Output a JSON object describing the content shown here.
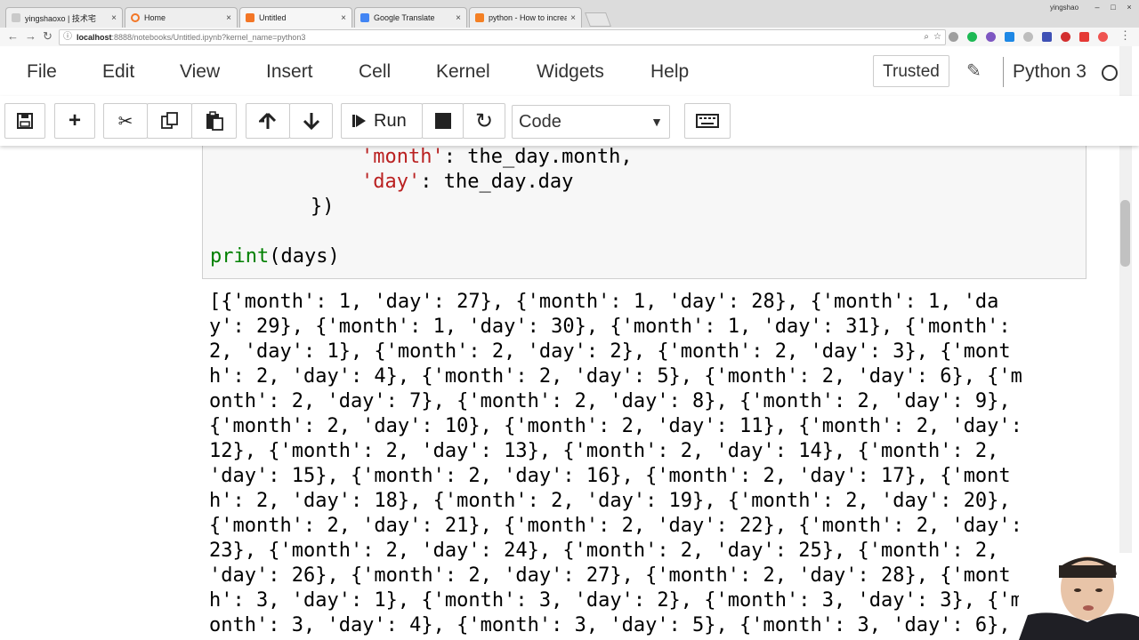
{
  "browser": {
    "tabs": [
      {
        "title": "yingshaoxo | 技术宅",
        "favicon_color": "#c9c9c9",
        "active": false
      },
      {
        "title": "Home",
        "favicon_color": "#f37626",
        "active": false
      },
      {
        "title": "Untitled",
        "favicon_color": "#f37626",
        "active": true
      },
      {
        "title": "Google Translate",
        "favicon_color": "#4285f4",
        "active": false
      },
      {
        "title": "python - How to increa",
        "favicon_color": "#f48024",
        "active": false
      }
    ],
    "close_glyph": "×",
    "user_label": "yingshao",
    "url_host": "localhost",
    "url_rest": ":8888/notebooks/Untitled.ipynb?kernel_name=python3"
  },
  "menu": {
    "items": [
      "File",
      "Edit",
      "View",
      "Insert",
      "Cell",
      "Kernel",
      "Widgets",
      "Help"
    ],
    "trusted": "Trusted",
    "kernel_name": "Python 3"
  },
  "toolbar": {
    "run_label": "Run",
    "cell_type": "Code"
  },
  "input_cell": {
    "line1_str": "'month'",
    "line1_rest": ": the_day.month,",
    "line2_str": "'day'",
    "line2_rest": ": the_day.day",
    "line3": "})",
    "line4_kw": "print",
    "line4_rest": "(days)"
  },
  "output_lines": [
    "[{'month': 1, 'day': 27}, {'month': 1, 'day': 28}, {'month': 1, 'da",
    "y': 29}, {'month': 1, 'day': 30}, {'month': 1, 'day': 31}, {'month':",
    "2, 'day': 1}, {'month': 2, 'day': 2}, {'month': 2, 'day': 3}, {'mont",
    "h': 2, 'day': 4}, {'month': 2, 'day': 5}, {'month': 2, 'day': 6}, {'m",
    "onth': 2, 'day': 7}, {'month': 2, 'day': 8}, {'month': 2, 'day': 9},",
    "{'month': 2, 'day': 10}, {'month': 2, 'day': 11}, {'month': 2, 'day':",
    "12}, {'month': 2, 'day': 13}, {'month': 2, 'day': 14}, {'month': 2,",
    "'day': 15}, {'month': 2, 'day': 16}, {'month': 2, 'day': 17}, {'mont",
    "h': 2, 'day': 18}, {'month': 2, 'day': 19}, {'month': 2, 'day': 20},",
    "{'month': 2, 'day': 21}, {'month': 2, 'day': 22}, {'month': 2, 'day':",
    "23}, {'month': 2, 'day': 24}, {'month': 2, 'day': 25}, {'month': 2,",
    "'day': 26}, {'month': 2, 'day': 27}, {'month': 2, 'day': 28}, {'mont",
    "h': 3, 'day': 1}, {'month': 3, 'day': 2}, {'month': 3, 'day': 3}, {'m",
    "onth': 3, 'day': 4}, {'month': 3, 'day': 5}, {'month': 3, 'day': 6},"
  ]
}
